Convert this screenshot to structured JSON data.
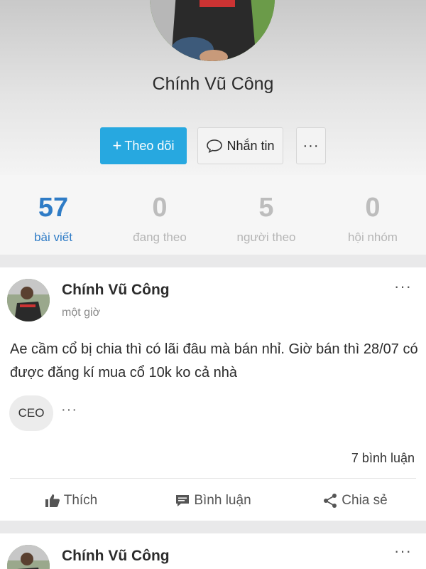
{
  "profile": {
    "name": "Chính Vũ Công",
    "follow_label": "Theo dõi",
    "follow_plus": "+",
    "message_label": "Nhắn tin",
    "more_label": "···"
  },
  "stats": [
    {
      "value": "57",
      "label": "bài viết"
    },
    {
      "value": "0",
      "label": "đang theo"
    },
    {
      "value": "5",
      "label": "người theo"
    },
    {
      "value": "0",
      "label": "hội nhóm"
    }
  ],
  "posts": [
    {
      "author": "Chính Vũ Công",
      "time": "một giờ",
      "menu": "···",
      "text": "Ae cầm cổ bị chia thì có lãi đâu mà bán nhỉ. Giờ bán thì 28/07 có được đăng kí mua cổ 10k ko cả nhà",
      "tag": "CEO",
      "tag_more": "···",
      "comments": "7 bình luận",
      "actions": {
        "like": "Thích",
        "comment": "Bình luận",
        "share": "Chia sẻ"
      }
    },
    {
      "author": "Chính Vũ Công",
      "menu": "···"
    }
  ],
  "colors": {
    "accent": "#27a8e0",
    "active_stat": "#2f7cc6"
  }
}
